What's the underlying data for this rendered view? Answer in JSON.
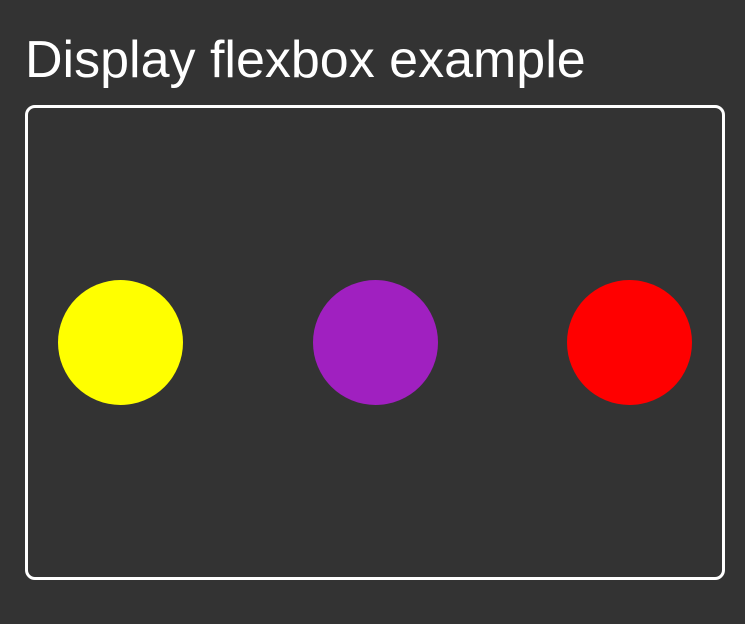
{
  "title": "Display flexbox example",
  "circles": [
    {
      "color": "#ffff00",
      "name": "yellow"
    },
    {
      "color": "#a020c0",
      "name": "purple"
    },
    {
      "color": "#ff0000",
      "name": "red"
    }
  ]
}
